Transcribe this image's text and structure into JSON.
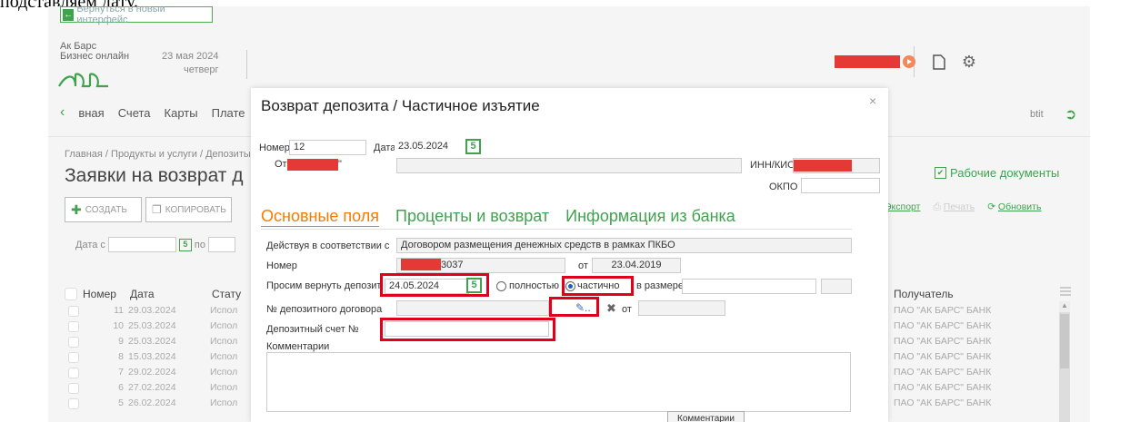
{
  "caption": "подставляем дату.",
  "back_button": "Вернуться в новый интерфейс",
  "brand": {
    "line1": "Ак Барс",
    "line2": "Бизнес онлайн",
    "mark": "Abb"
  },
  "header": {
    "date": "23 мая 2024",
    "weekday": "четверг"
  },
  "nav": {
    "items": [
      "вная",
      "Счета",
      "Карты",
      "Плате"
    ],
    "right_text": "btit"
  },
  "breadcrumb": "Главная / Продукты и услуги / Депозиты",
  "page_title": "Заявки на возврат д",
  "buttons": {
    "create": "СОЗДАТЬ",
    "copy": "КОПИРОВАТЬ"
  },
  "date_filter": {
    "from": "Дата с",
    "to": "по"
  },
  "list": {
    "headers": [
      "Номер",
      "Дата",
      "Стату"
    ],
    "rows": [
      {
        "num": "11",
        "date": "29.03.2024",
        "status": "Испол"
      },
      {
        "num": "10",
        "date": "25.03.2024",
        "status": "Испол"
      },
      {
        "num": "9",
        "date": "25.03.2024",
        "status": "Испол"
      },
      {
        "num": "8",
        "date": "15.03.2024",
        "status": "Испол"
      },
      {
        "num": "7",
        "date": "29.02.2024",
        "status": "Испол"
      },
      {
        "num": "6",
        "date": "27.02.2024",
        "status": "Испол"
      },
      {
        "num": "5",
        "date": "26.02.2024",
        "status": "Испол"
      }
    ]
  },
  "right_panel": {
    "title": "Рабочие документы",
    "links": [
      "Экспорт",
      "Печать",
      "Обновить"
    ],
    "recipient_header": "Получатель",
    "recipients": [
      "ПАО \"АК БАРС\" БАНК",
      "ПАО \"АК БАРС\" БАНК",
      "ПАО \"АК БАРС\" БАНК",
      "ПАО \"АК БАРС\" БАНК",
      "ПАО \"АК БАРС\" БАНК",
      "ПАО \"АК БАРС\" БАНК",
      "ПАО \"АК БАРС\" БАНК"
    ]
  },
  "modal": {
    "title": "Возврат депозита / Частичное изъятие",
    "close": "×",
    "number_label": "Номер",
    "number_value": "12",
    "date_label": "Дата",
    "date_value": "23.05.2024",
    "from_label": "От",
    "from_suffix": "\"",
    "inn_label": "ИНН/КИО",
    "okpo_label": "ОКПО",
    "tabs": [
      "Основные поля",
      "Проценты и возврат",
      "Информация из банка"
    ],
    "actions_label": "Действуя в соответствии с",
    "actions_value": "Договором размещения денежных средств в рамках ПКБО",
    "contract_number_label": "Номер",
    "contract_number_value": "3037",
    "contract_from_label": "от",
    "contract_date": "23.04.2019",
    "return_label": "Просим вернуть депозит",
    "return_date": "24.05.2024",
    "radio_full": "полностью",
    "radio_partial": "частично",
    "amount_label": "в размере",
    "deposit_contract_label": "№ депозитного договора",
    "deposit_from_label": "от",
    "deposit_account_label": "Депозитный счет №",
    "comments_label": "Комментарии",
    "comments_button": "Комментарии"
  },
  "colors": {
    "accent_green": "#3fa34d",
    "active_tab": "#f57c00",
    "highlight": "#e0001b",
    "redaction": "#e53935"
  }
}
